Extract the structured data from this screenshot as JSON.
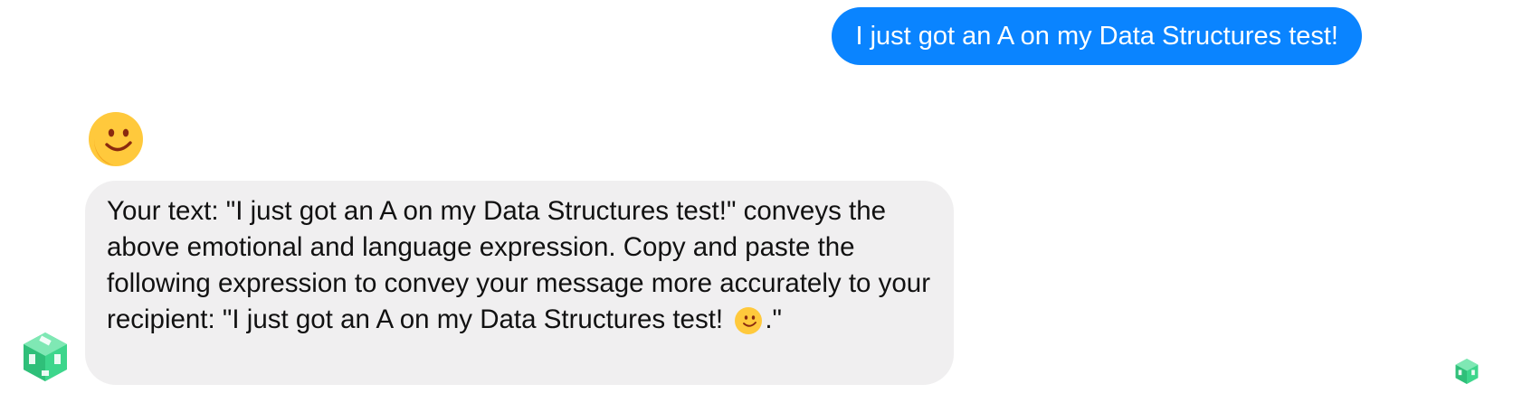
{
  "conversation": {
    "user_message": "I just got an A on my Data Structures test!",
    "bot_reaction_icon": "slightly-smiling-face",
    "bot_message": {
      "before_emoji": "Your text: \"I just got an A on my Data Structures test!\" conveys the above emotional and language expression. Copy and paste the following expression to convey your message more accurately to your recipient: \"I just got an A on my Data Structures test! ",
      "inline_icon": "slightly-smiling-face",
      "after_emoji": ".\""
    },
    "bot_avatar_icon": "green-cube-bot",
    "seen_indicator_icon": "green-cube-bot"
  },
  "colors": {
    "user_bubble": "#0a84ff",
    "bot_bubble": "#f0eff0",
    "bot_avatar": "#3dd68c",
    "emoji_face": "#ffc93c",
    "emoji_features": "#8a2a0f"
  }
}
